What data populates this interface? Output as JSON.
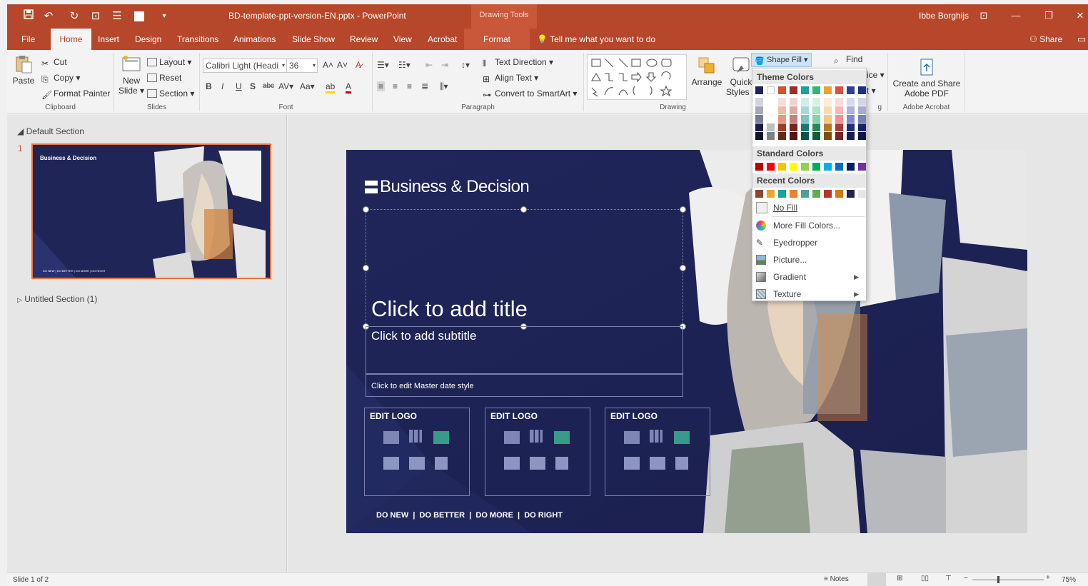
{
  "titlebar": {
    "filename": "BD-template-ppt-version-EN.pptx  -  PowerPoint",
    "contextual": "Drawing Tools",
    "user": "Ibbe Borghijs"
  },
  "tabs": {
    "file": "File",
    "home": "Home",
    "insert": "Insert",
    "design": "Design",
    "transitions": "Transitions",
    "animations": "Animations",
    "slideshow": "Slide Show",
    "review": "Review",
    "view": "View",
    "acrobat": "Acrobat",
    "format": "Format",
    "tellme": "Tell me what you want to do",
    "share": "Share"
  },
  "ribbon": {
    "clipboard": {
      "paste": "Paste",
      "cut": "Cut",
      "copy": "Copy",
      "format_painter": "Format Painter",
      "label": "Clipboard"
    },
    "slides": {
      "new_slide_1": "New",
      "new_slide_2": "Slide",
      "layout": "Layout",
      "reset": "Reset",
      "section": "Section",
      "label": "Slides"
    },
    "font": {
      "name": "Calibri Light (Headi",
      "size": "36",
      "label": "Font"
    },
    "paragraph": {
      "text_direction": "Text Direction",
      "align_text": "Align Text",
      "convert_smartart": "Convert to SmartArt",
      "label": "Paragraph"
    },
    "drawing": {
      "arrange": "Arrange",
      "quick_1": "Quick",
      "quick_2": "Styles",
      "shape_fill": "Shape Fill",
      "label": "Drawing"
    },
    "editing": {
      "find": "Find",
      "replace_partial": "ice",
      "select_partial": "t",
      "label_partial": "g"
    },
    "adobe": {
      "line1": "Create and Share",
      "line2": "Adobe PDF",
      "label": "Adobe Acrobat"
    }
  },
  "sections": {
    "default": "Default Section",
    "untitled": "Untitled Section (1)",
    "slide_number": "1"
  },
  "thumbnail": {
    "brand": "Business & Decision",
    "footer": "DO NEW | DO BETTER | DO MORE | DO RIGHT"
  },
  "slide": {
    "brand": "Business & Decision",
    "title_placeholder": "Click to add title",
    "subtitle_placeholder": "Click to add subtitle",
    "date_placeholder": "Click to edit Master date style",
    "logo_boxes": [
      "EDIT LOGO",
      "EDIT LOGO",
      "EDIT LOGO"
    ],
    "tagline": "DO NEW  |  DO BETTER  |  DO MORE  |  DO RIGHT"
  },
  "shape_fill_menu": {
    "theme_colors_label": "Theme Colors",
    "theme_colors": [
      "#1f2557",
      "#ffffff",
      "#d3552b",
      "#a52a2a",
      "#1aa39a",
      "#2eb872",
      "#f0a02c",
      "#e84a4a",
      "#2b3da8",
      "#1c2f8a"
    ],
    "standard_colors_label": "Standard Colors",
    "standard_colors": [
      "#c00000",
      "#ff0000",
      "#ffc000",
      "#ffff00",
      "#92d050",
      "#00b050",
      "#00b0f0",
      "#0070c0",
      "#002060",
      "#7030a0"
    ],
    "recent_colors_label": "Recent Colors",
    "recent_colors": [
      "#8b4a2b",
      "#e8a82c",
      "#1aa39a",
      "#e8822c",
      "#4aa39a",
      "#6aa84f",
      "#b03a2e",
      "#d07a1a",
      "#1f2557",
      "#e6e6e6"
    ],
    "items": [
      "No Fill",
      "More Fill Colors...",
      "Eyedropper",
      "Picture...",
      "Gradient",
      "Texture"
    ]
  },
  "statusbar": {
    "slide_info": "Slide 1 of 2",
    "notes": "Notes",
    "zoom": "75%"
  }
}
